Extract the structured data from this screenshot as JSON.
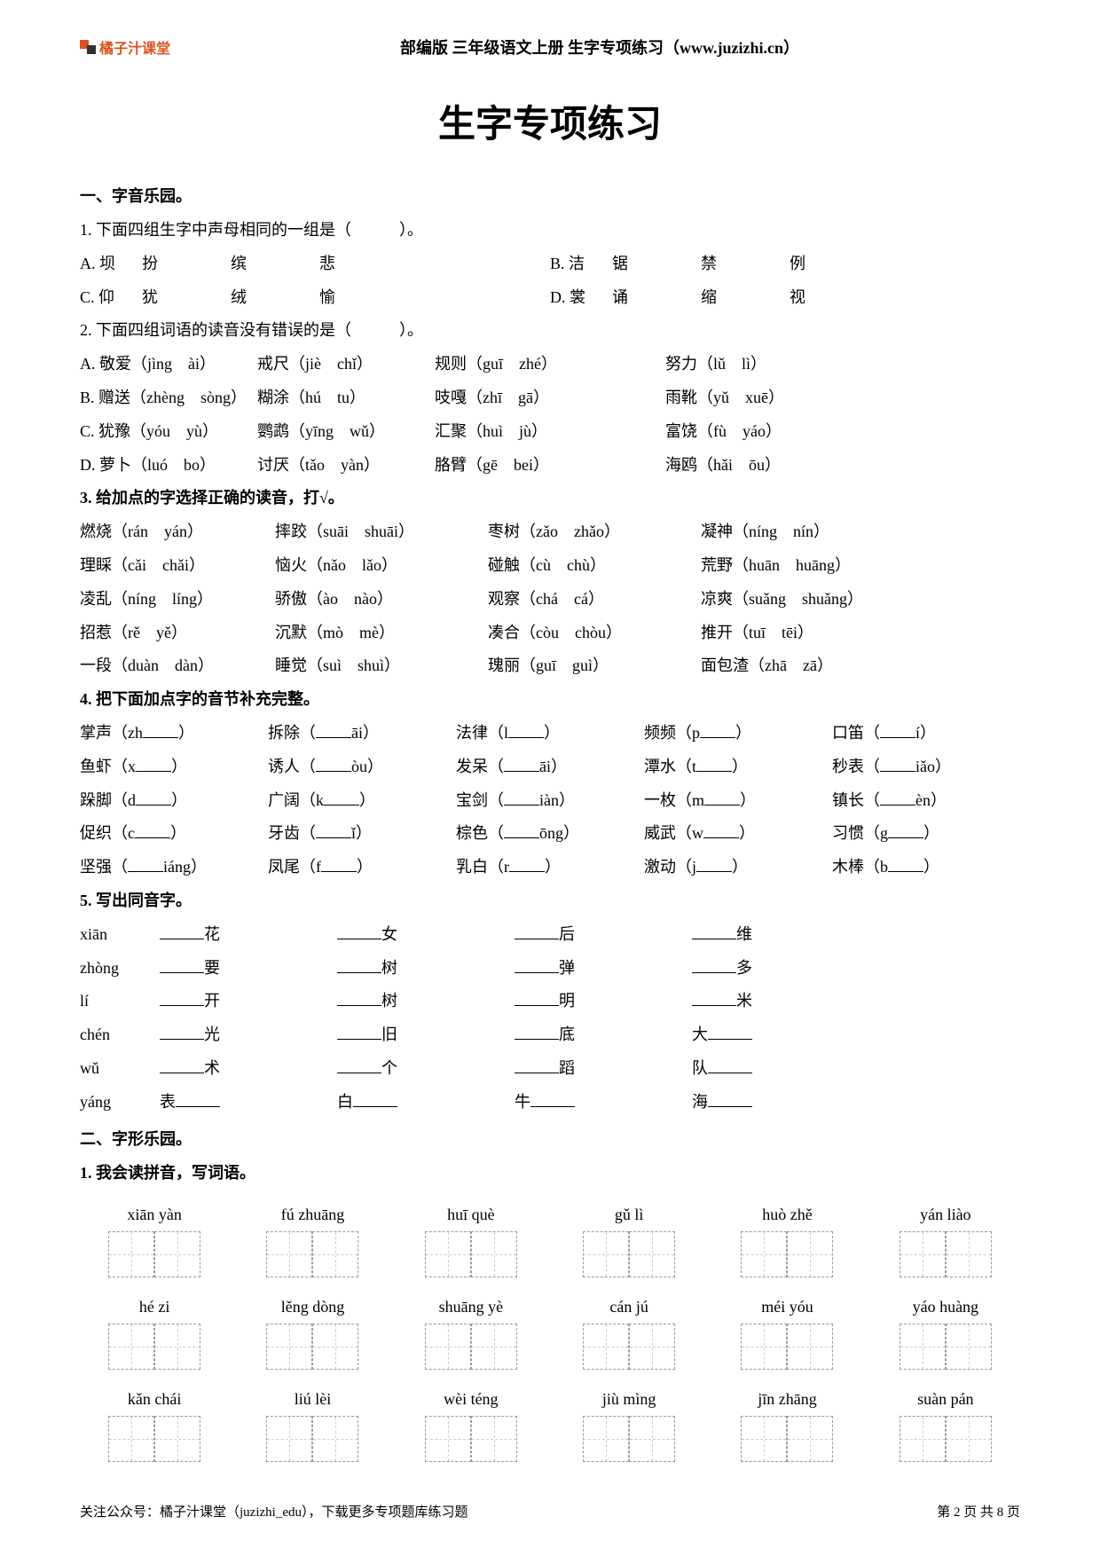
{
  "header": {
    "brand": "橘子汁课堂",
    "center": "部编版  三年级语文上册  生字专项练习（www.juzizhi.cn）"
  },
  "title": "生字专项练习",
  "sec1": {
    "head": "一、字音乐园。",
    "q1": {
      "stem": "1. 下面四组生字中声母相同的一组是（　　　）。",
      "A": [
        "A. 坝",
        "扮",
        "缤",
        "悲"
      ],
      "B": [
        "B. 洁",
        "锯",
        "禁",
        "例"
      ],
      "C": [
        "C. 仰",
        "犹",
        "绒",
        "愉"
      ],
      "D": [
        "D. 裳",
        "诵",
        "缩",
        "视"
      ]
    },
    "q2": {
      "stem": "2. 下面四组词语的读音没有错误的是（　　　）。",
      "rows": [
        [
          "A. 敬爱（jìng　ài）",
          "戒尺（jiè　chǐ）",
          "规则（guī　zhé）",
          "努力（lǔ　lì）"
        ],
        [
          "B. 赠送（zhèng　sòng）",
          "糊涂（hú　tu）",
          "吱嘎（zhī　gā）",
          "雨靴（yǔ　xuē）"
        ],
        [
          "C. 犹豫（yóu　yù）",
          "鹦鹉（yīng　wǔ）",
          "汇聚（huì　jù）",
          "富饶（fù　yáo）"
        ],
        [
          "D. 萝卜（luó　bo）",
          "讨厌（tǎo　yàn）",
          "胳臂（gē　bei）",
          "海鸥（hǎi　ōu）"
        ]
      ]
    },
    "q3": {
      "stem": "3. 给加点的字选择正确的读音，打√。",
      "rows": [
        [
          "燃烧（rán　yán）",
          "摔跤（suāi　shuāi）",
          "枣树（zǎo　zhǎo）",
          "凝神（níng　nín）"
        ],
        [
          "理睬（cǎi　chǎi）",
          "恼火（nǎo　lǎo）",
          "碰触（cù　chù）",
          "荒野（huān　huāng）"
        ],
        [
          "凌乱（níng　líng）",
          "骄傲（ào　nào）",
          "观察（chá　cá）",
          "凉爽（suǎng　shuǎng）"
        ],
        [
          "招惹（rě　yě）",
          "沉默（mò　mè）",
          "凑合（còu　chòu）",
          "推开（tuī　tēi）"
        ],
        [
          "一段（duàn　dàn）",
          "睡觉（suì　shuì）",
          "瑰丽（guī　guì）",
          "面包渣（zhā　zā）"
        ]
      ]
    },
    "q4": {
      "stem": "4. 把下面加点字的音节补充完整。",
      "rows": [
        [
          {
            "w": "掌声",
            "p": "zh",
            "pos": "after"
          },
          {
            "w": "拆除",
            "p": "āi",
            "pos": "before"
          },
          {
            "w": "法律",
            "p": "l",
            "pos": "after"
          },
          {
            "w": "频频",
            "p": "p",
            "pos": "after"
          },
          {
            "w": "口笛",
            "p": "í",
            "pos": "before"
          }
        ],
        [
          {
            "w": "鱼虾",
            "p": "x",
            "pos": "after"
          },
          {
            "w": "诱人",
            "p": "òu",
            "pos": "before"
          },
          {
            "w": "发呆",
            "p": "āi",
            "pos": "before"
          },
          {
            "w": "潭水",
            "p": "t",
            "pos": "after"
          },
          {
            "w": "秒表",
            "p": "iǎo",
            "pos": "before"
          }
        ],
        [
          {
            "w": "跺脚",
            "p": "d",
            "pos": "after"
          },
          {
            "w": "广阔",
            "p": "k",
            "pos": "after"
          },
          {
            "w": "宝剑",
            "p": "iàn",
            "pos": "before"
          },
          {
            "w": "一枚",
            "p": "m",
            "pos": "after"
          },
          {
            "w": "镇长",
            "p": "èn",
            "pos": "before"
          }
        ],
        [
          {
            "w": "促织",
            "p": "c",
            "pos": "after"
          },
          {
            "w": "牙齿",
            "p": "ǐ",
            "pos": "before"
          },
          {
            "w": "棕色",
            "p": "ōng",
            "pos": "before"
          },
          {
            "w": "威武",
            "p": "w",
            "pos": "after"
          },
          {
            "w": "习惯",
            "p": "g",
            "pos": "after"
          }
        ],
        [
          {
            "w": "坚强",
            "p": "iáng",
            "pos": "before"
          },
          {
            "w": "凤尾",
            "p": "f",
            "pos": "after"
          },
          {
            "w": "乳白",
            "p": "r",
            "pos": "after"
          },
          {
            "w": "激动",
            "p": "j",
            "pos": "after"
          },
          {
            "w": "木棒",
            "p": "b",
            "pos": "after"
          }
        ]
      ]
    },
    "q5": {
      "stem": "5. 写出同音字。",
      "rows": [
        {
          "py": "xiān",
          "cells": [
            {
              "t": "花",
              "pos": "after"
            },
            {
              "t": "女",
              "pos": "after"
            },
            {
              "t": "后",
              "pos": "after"
            },
            {
              "t": "维",
              "pos": "after"
            }
          ]
        },
        {
          "py": "zhòng",
          "cells": [
            {
              "t": "要",
              "pos": "after"
            },
            {
              "t": "树",
              "pos": "after"
            },
            {
              "t": "弹",
              "pos": "after"
            },
            {
              "t": "多",
              "pos": "after"
            }
          ]
        },
        {
          "py": "lí",
          "cells": [
            {
              "t": "开",
              "pos": "after"
            },
            {
              "t": "树",
              "pos": "after"
            },
            {
              "t": "明",
              "pos": "after"
            },
            {
              "t": "米",
              "pos": "after"
            }
          ]
        },
        {
          "py": "chén",
          "cells": [
            {
              "t": "光",
              "pos": "after"
            },
            {
              "t": "旧",
              "pos": "after"
            },
            {
              "t": "底",
              "pos": "after"
            },
            {
              "t": "大",
              "pos": "before"
            }
          ]
        },
        {
          "py": "wǔ",
          "cells": [
            {
              "t": "术",
              "pos": "after"
            },
            {
              "t": "个",
              "pos": "after"
            },
            {
              "t": "蹈",
              "pos": "after"
            },
            {
              "t": "队",
              "pos": "before"
            }
          ]
        },
        {
          "py": "yáng",
          "cells": [
            {
              "t": "表",
              "pos": "before"
            },
            {
              "t": "白",
              "pos": "before"
            },
            {
              "t": "牛",
              "pos": "before"
            },
            {
              "t": "海",
              "pos": "before"
            }
          ]
        }
      ]
    }
  },
  "sec2": {
    "head": "二、字形乐园。",
    "q1": {
      "stem": "1. 我会读拼音，写词语。",
      "rows": [
        [
          "xiān yàn",
          "fú zhuāng",
          "huī què",
          "gǔ lì",
          "huò zhě",
          "yán liào"
        ],
        [
          "hé zi",
          "lěng dòng",
          "shuāng yè",
          "cán jú",
          "méi yóu",
          "yáo huàng"
        ],
        [
          "kǎn chái",
          "liú lèi",
          "wèi téng",
          "jiù mìng",
          "jīn zhāng",
          "suàn pán"
        ]
      ]
    }
  },
  "footer": {
    "left": "关注公众号：橘子汁课堂（juzizhi_edu），下载更多专项题库练习题",
    "right": "第 2 页 共 8 页"
  }
}
